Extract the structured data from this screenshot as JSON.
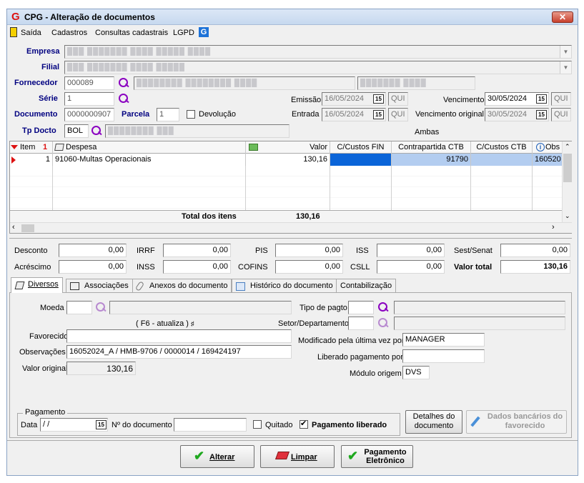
{
  "window": {
    "title": "CPG - Alteração de documentos",
    "close": "✕"
  },
  "menu": {
    "items": [
      "Saída",
      "Cadastros",
      "Consultas cadastrais",
      "LGPD"
    ]
  },
  "header": {
    "empresa_label": "Empresa",
    "filial_label": "Filial",
    "fornecedor_label": "Fornecedor",
    "serie_label": "Série",
    "documento_label": "Documento",
    "parcela_label": "Parcela",
    "devolucao_label": "Devolução",
    "tpdocto_label": "Tp Docto",
    "fornecedor_code": "000089",
    "serie": "1",
    "documento": "0000000907",
    "parcela": "1",
    "tpdocto": "BOL",
    "emissao_label": "Emissão",
    "emissao": "16/05/2024",
    "emissao_day": "QUI",
    "entrada_label": "Entrada",
    "entrada": "16/05/2024",
    "entrada_day": "QUI",
    "vencimento_label": "Vencimento",
    "vencimento": "30/05/2024",
    "vencimento_day": "QUI",
    "venc_original_label": "Vencimento original",
    "venc_original": "30/05/2024",
    "venc_original_day": "QUI",
    "ambas": "Ambas",
    "cal": "15"
  },
  "grid": {
    "columns": [
      "Item",
      "Despesa",
      "Valor",
      "C/Custos FIN",
      "Contrapartida CTB",
      "C/Custos CTB",
      "Obs"
    ],
    "rows": [
      {
        "item": "1",
        "despesa": "91060-Multas Operacionais",
        "valor": "130,16",
        "ccfin": "",
        "contrapartida": "91790",
        "ccctb": "",
        "obs": "160520"
      }
    ],
    "total_label": "Total dos itens",
    "total": "130,16"
  },
  "totals": {
    "desconto_label": "Desconto",
    "desconto": "0,00",
    "irrf_label": "IRRF",
    "irrf": "0,00",
    "pis_label": "PIS",
    "pis": "0,00",
    "iss_label": "ISS",
    "iss": "0,00",
    "sest_label": "Sest/Senat",
    "sest": "0,00",
    "acrescimo_label": "Acréscimo",
    "acrescimo": "0,00",
    "inss_label": "INSS",
    "inss": "0,00",
    "cofins_label": "COFINS",
    "cofins": "0,00",
    "csll_label": "CSLL",
    "csll": "0,00",
    "valor_total_label": "Valor total",
    "valor_total": "130,16"
  },
  "tabs": [
    "Diversos",
    "Associações",
    "Anexos do documento",
    "Histórico do documento",
    "Contabilização"
  ],
  "diversos": {
    "moeda_label": "Moeda",
    "f6": "( F6 - atualiza )",
    "favorecido_label": "Favorecido",
    "obs_label": "Observações",
    "obs": "16052024_A / HMB-9706 / 0000014 / 169424197",
    "valor_original_label": "Valor original",
    "valor_original": "130,16",
    "tipo_pagto_label": "Tipo de pagto",
    "setor_label": "Setor/Departamento",
    "modificado_label": "Modificado pela última vez por",
    "modificado": "MANAGER",
    "liberado_label": "Liberado pagamento por",
    "modulo_label": "Módulo origem",
    "modulo": "DVS",
    "pagamento_legend": "Pagamento",
    "data_label": "Data",
    "data": " /  /",
    "ndoc_label": "Nº do documento",
    "quitado_label": "Quitado",
    "pag_liberado_label": "Pagamento liberado",
    "detalhes_btn": "Detalhes do documento",
    "dados_btn": "Dados bancários do favorecido"
  },
  "buttons": {
    "alterar": "Alterar",
    "limpar": "Limpar",
    "pagamento": "Pagamento Eletrônico"
  }
}
